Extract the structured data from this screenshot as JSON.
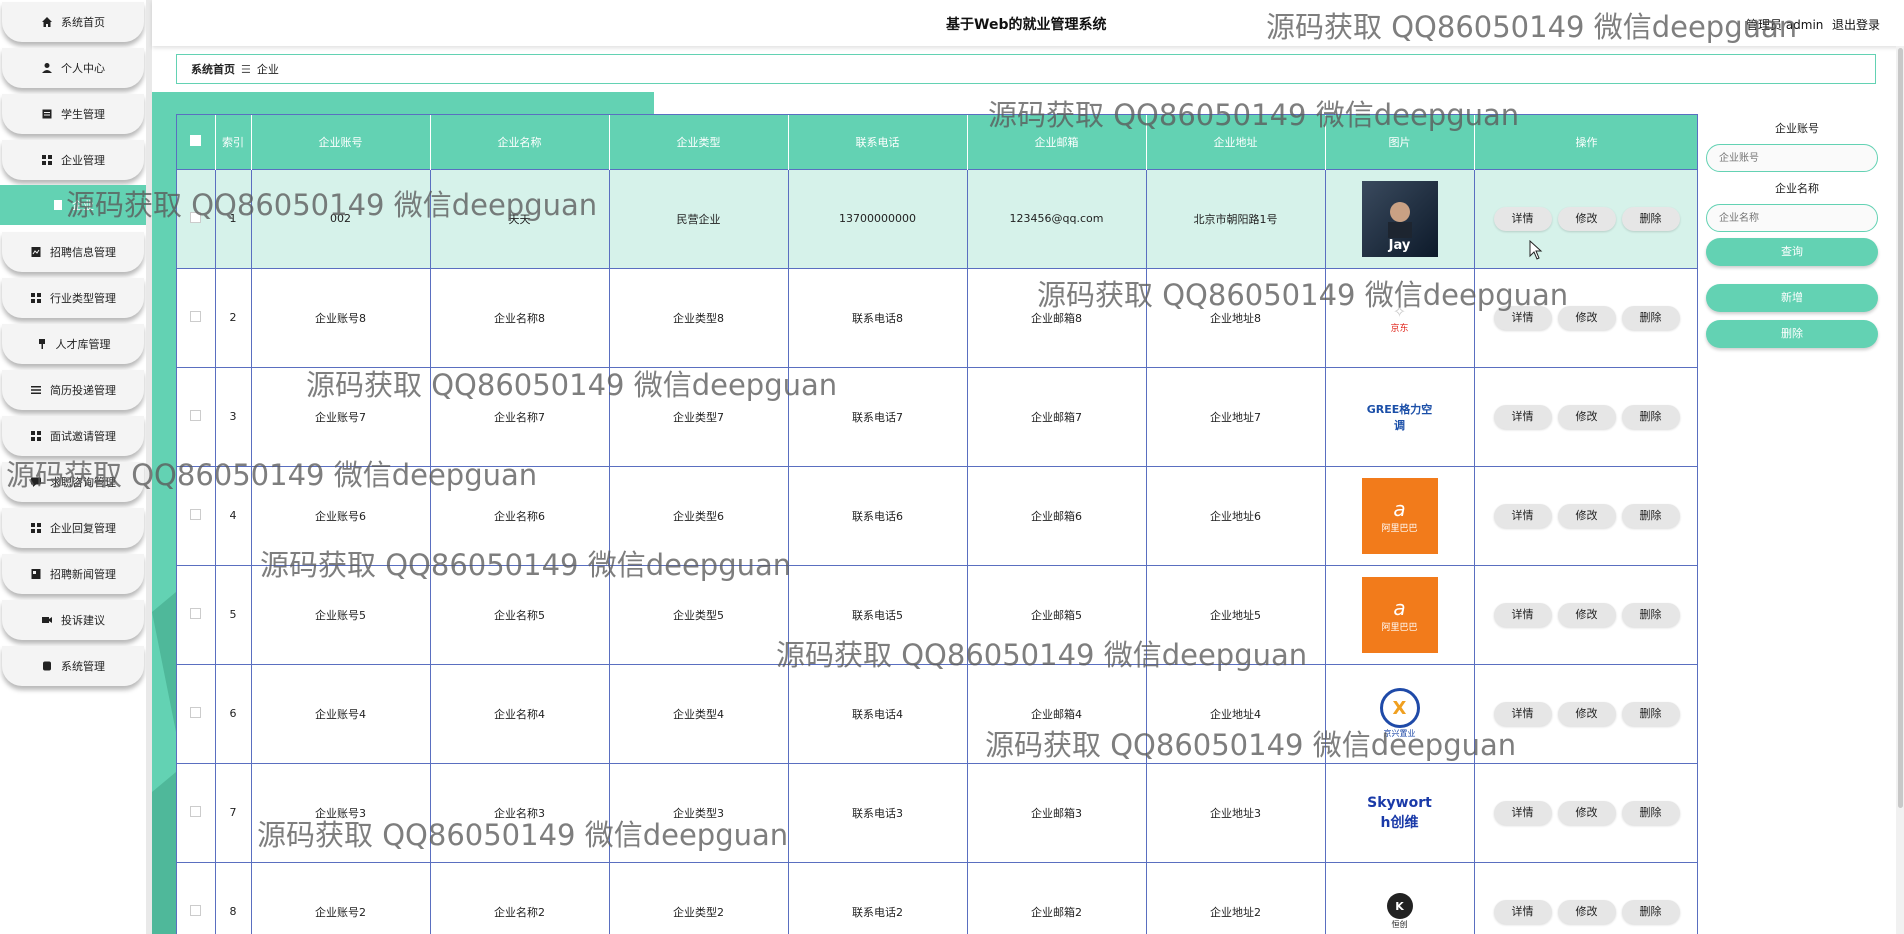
{
  "app": {
    "title": "基于Web的就业管理系统",
    "user_label": "管理员 admin",
    "logout_label": "退出登录"
  },
  "breadcrumb": {
    "home": "系统首页",
    "current": "企业"
  },
  "sidebar": {
    "items": [
      {
        "label": "系统首页",
        "icon": "home-icon"
      },
      {
        "label": "个人中心",
        "icon": "user-icon"
      },
      {
        "label": "学生管理",
        "icon": "student-icon"
      },
      {
        "label": "企业管理",
        "icon": "grid-icon"
      },
      {
        "label": "企业",
        "icon": "building-icon",
        "active": true
      },
      {
        "label": "招聘信息管理",
        "icon": "doc-icon"
      },
      {
        "label": "行业类型管理",
        "icon": "grid-icon"
      },
      {
        "label": "人才库管理",
        "icon": "pin-icon"
      },
      {
        "label": "简历投递管理",
        "icon": "list-icon"
      },
      {
        "label": "面试邀请管理",
        "icon": "grid-icon"
      },
      {
        "label": "求职咨询管理",
        "icon": "chat-icon"
      },
      {
        "label": "企业回复管理",
        "icon": "grid-icon"
      },
      {
        "label": "招聘新闻管理",
        "icon": "news-icon"
      },
      {
        "label": "投诉建议",
        "icon": "camera-icon"
      },
      {
        "label": "系统管理",
        "icon": "settings-icon"
      }
    ]
  },
  "table": {
    "headers": [
      "索引",
      "企业账号",
      "企业名称",
      "企业类型",
      "联系电话",
      "企业邮箱",
      "企业地址",
      "图片",
      "操作"
    ],
    "actions": {
      "detail": "详情",
      "edit": "修改",
      "delete": "删除"
    },
    "rows": [
      {
        "index": "1",
        "account": "002",
        "name": "天天",
        "type": "民营企业",
        "phone": "13700000000",
        "email": "123456@qq.com",
        "address": "北京市朝阳路1号",
        "logo": "jay-photo",
        "logo_text": "Jay"
      },
      {
        "index": "2",
        "account": "企业账号8",
        "name": "企业名称8",
        "type": "企业类型8",
        "phone": "联系电话8",
        "email": "企业邮箱8",
        "address": "企业地址8",
        "logo": "jd-logo",
        "logo_text": "京东"
      },
      {
        "index": "3",
        "account": "企业账号7",
        "name": "企业名称7",
        "type": "企业类型7",
        "phone": "联系电话7",
        "email": "企业邮箱7",
        "address": "企业地址7",
        "logo": "gree-logo",
        "logo_text": "GREE格力空调"
      },
      {
        "index": "4",
        "account": "企业账号6",
        "name": "企业名称6",
        "type": "企业类型6",
        "phone": "联系电话6",
        "email": "企业邮箱6",
        "address": "企业地址6",
        "logo": "alibaba-logo",
        "logo_text": "阿里巴巴"
      },
      {
        "index": "5",
        "account": "企业账号5",
        "name": "企业名称5",
        "type": "企业类型5",
        "phone": "联系电话5",
        "email": "企业邮箱5",
        "address": "企业地址5",
        "logo": "alibaba-logo",
        "logo_text": "阿里巴巴"
      },
      {
        "index": "6",
        "account": "企业账号4",
        "name": "企业名称4",
        "type": "企业类型4",
        "phone": "联系电话4",
        "email": "企业邮箱4",
        "address": "企业地址4",
        "logo": "jx-logo",
        "logo_text": "京兴置业"
      },
      {
        "index": "7",
        "account": "企业账号3",
        "name": "企业名称3",
        "type": "企业类型3",
        "phone": "联系电话3",
        "email": "企业邮箱3",
        "address": "企业地址3",
        "logo": "skyworth-logo",
        "logo_text": "Skyworth创维"
      },
      {
        "index": "8",
        "account": "企业账号2",
        "name": "企业名称2",
        "type": "企业类型2",
        "phone": "联系电话2",
        "email": "企业邮箱2",
        "address": "企业地址2",
        "logo": "k-logo",
        "logo_text": "恒创"
      }
    ]
  },
  "search": {
    "account_label": "企业账号",
    "account_placeholder": "企业账号",
    "name_label": "企业名称",
    "name_placeholder": "企业名称",
    "query_button": "查询",
    "add_button": "新增",
    "delete_button": "删除"
  },
  "watermark_text": "源码获取 QQ86050149 微信deepguan",
  "colors": {
    "accent": "#63d2b3",
    "border": "#5a6fc0",
    "alibaba": "#f27b1b",
    "skyworth": "#1a3aa8"
  }
}
